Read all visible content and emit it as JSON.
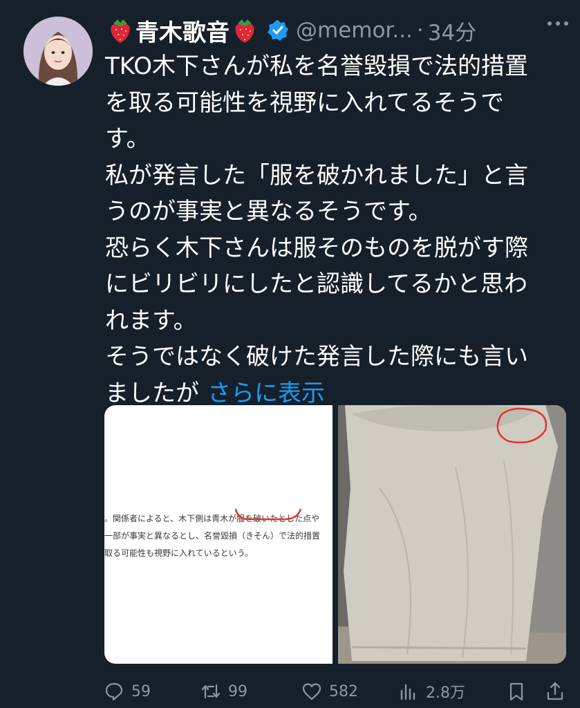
{
  "author": {
    "display_name": "青木歌音",
    "handle": "@memor...",
    "separator": "·",
    "time": "34分"
  },
  "tweet": {
    "lines": [
      "TKO木下さんが私を名誉毀損で法的措置",
      "を取る可能性を視野に入れてるそうで",
      "す。",
      "私が発言した「服を破かれました」と言",
      "うのが事実と異なるそうです。",
      "恐らく木下さんは服そのものを脱がす際",
      "にビリビリにしたと認識してるかと思わ",
      "れます。",
      "そうではなく破けた発言した際にも言い",
      "ましたが"
    ],
    "show_more": "さらに表示"
  },
  "media": {
    "article_lines": [
      "。関係者によると、木下側は青木が服を破いたとした点や",
      "一部が事実と異なるとし、名誉毀損（きそん）で法的措置",
      "取る可能性も視野に入れているという。"
    ]
  },
  "actions": {
    "replies": "59",
    "retweets": "99",
    "likes": "582",
    "views": "2.8万"
  },
  "colors": {
    "background": "#15202b",
    "text": "#ffffff",
    "muted": "#8b98a5",
    "link": "#1d9bf0",
    "verified": "#1d9bf0",
    "annotation": "#e0352b"
  }
}
